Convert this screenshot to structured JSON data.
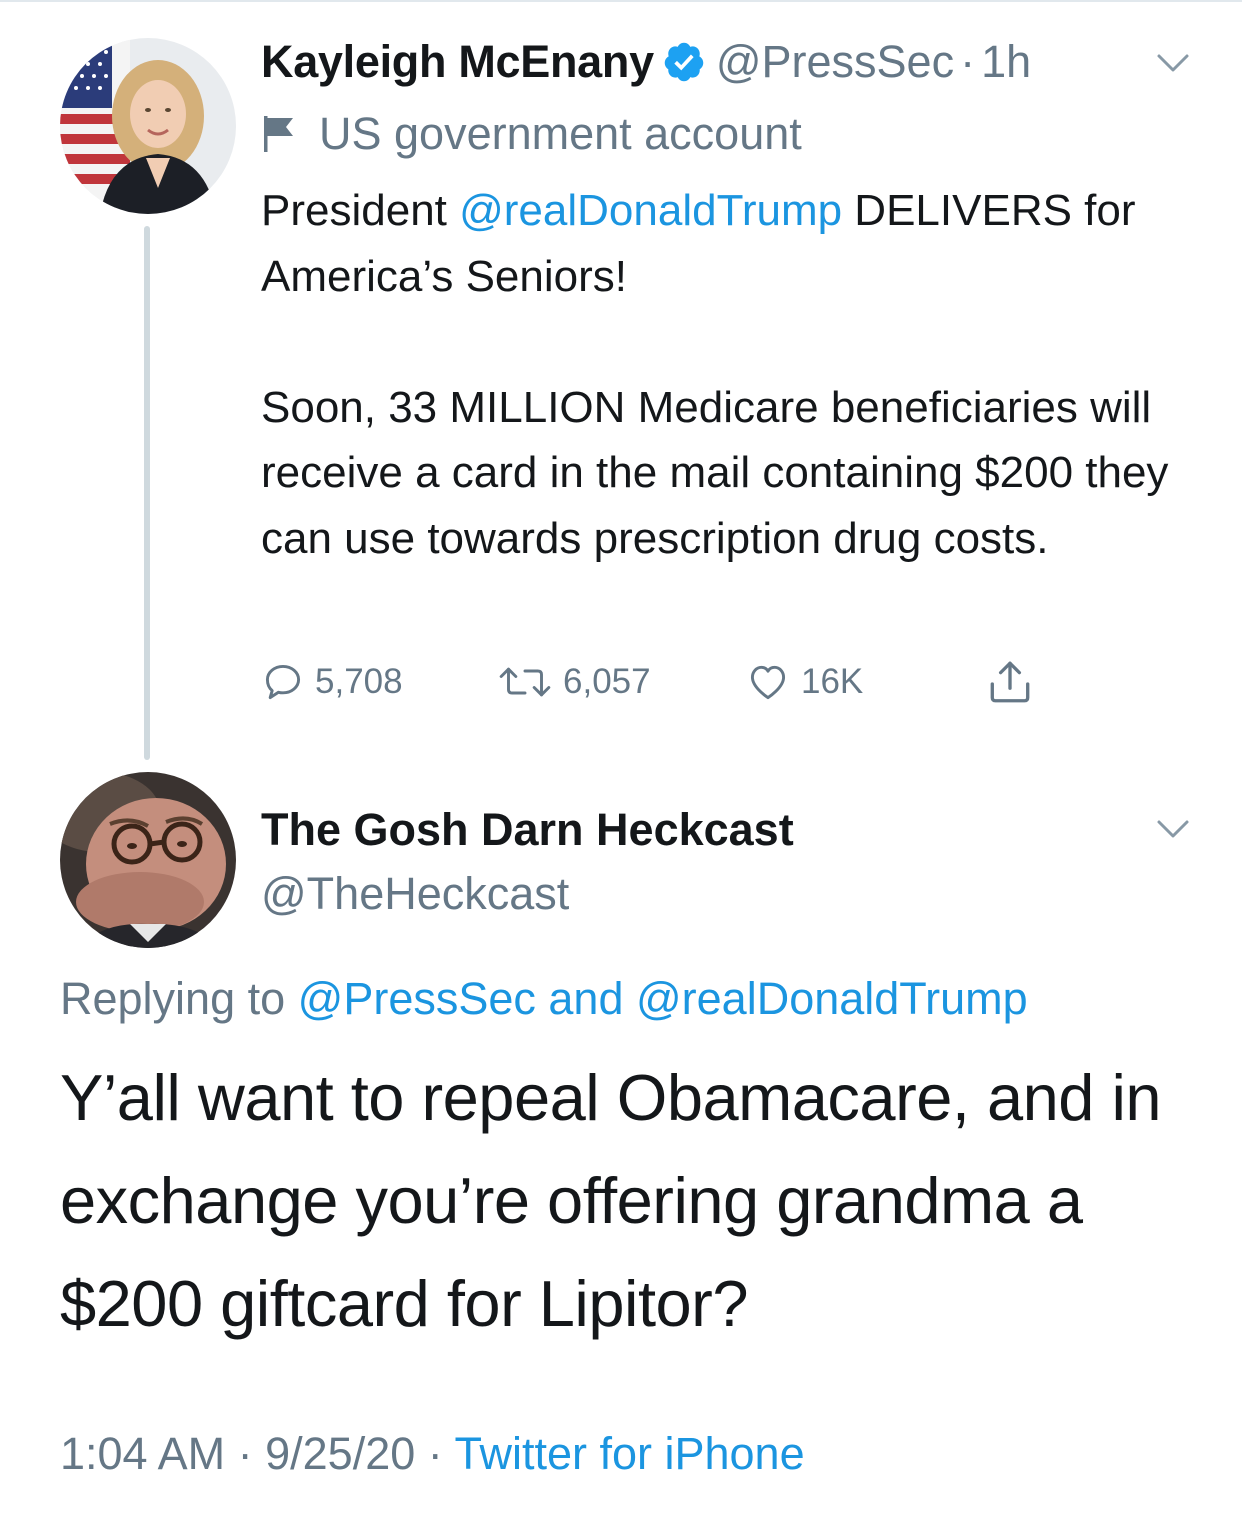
{
  "parent_tweet": {
    "display_name": "Kayleigh McEnany",
    "handle": "@PressSec",
    "separator": "·",
    "time_ago": "1h",
    "label": "US government account",
    "text_intro": "President ",
    "text_mention": "@realDonaldTrump",
    "text_after_mention": " DELIVERS for America’s Seniors!",
    "text_paragraph_2": "Soon, 33 MILLION Medicare beneficiaries will receive a card in the mail containing $200 they can use towards prescription drug costs.",
    "reply_count": "5,708",
    "retweet_count": "6,057",
    "like_count": "16K"
  },
  "reply_tweet": {
    "display_name": "The Gosh Darn Heckcast",
    "handle": "@TheHeckcast",
    "replying_to_label": "Replying to ",
    "replying_to_user_1": "@PressSec",
    "replying_to_and": " and ",
    "replying_to_user_2": "@realDonaldTrump",
    "text": "Y’all want to repeal Obamacare, and in exchange you’re offering grandma a $200 giftcard for Lipitor?",
    "time": "1:04 AM",
    "date": "9/25/20",
    "meta_separator": " · ",
    "source": "Twitter for iPhone"
  },
  "icons": {
    "verified": "verified-badge-icon",
    "flag": "flag-icon",
    "caret": "chevron-down-icon",
    "reply": "reply-icon",
    "retweet": "retweet-icon",
    "like": "heart-icon",
    "share": "share-icon"
  },
  "colors": {
    "link": "#1b95e0",
    "secondary_text": "#657786",
    "primary_text": "#14171a",
    "thread_line": "#cfd9de",
    "verified_badge": "#1da1f2"
  }
}
